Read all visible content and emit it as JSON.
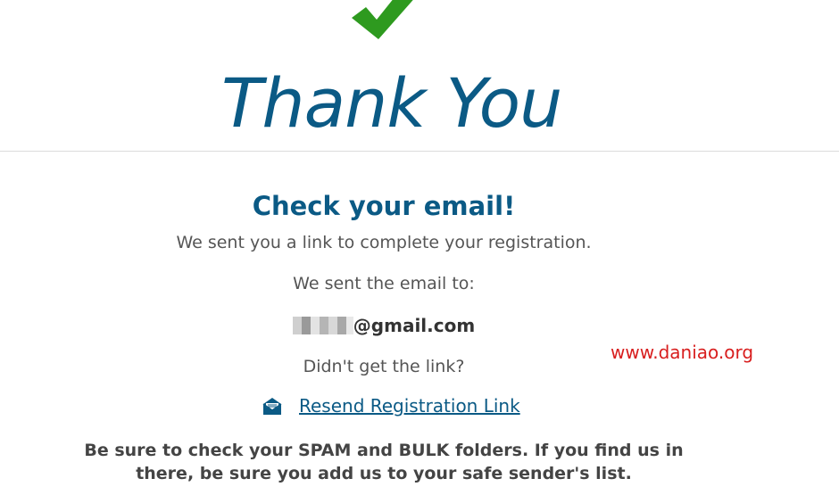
{
  "hero": {
    "title": "Thank You",
    "check_icon": "checkmark-icon",
    "check_color": "#2e9a1f"
  },
  "confirmation": {
    "heading": "Check your email!",
    "sent_link_text": "We sent you a link to complete your registration.",
    "sent_to_label": "We sent the email to:",
    "email_domain": "@gmail.com",
    "didnt_get_text": "Didn't get the link?",
    "resend_icon": "open-envelope-icon",
    "resend_label": "Resend Registration Link",
    "spam_notice": "Be sure to check your SPAM and BULK folders. If you find us in there, be sure you add us to your safe sender's list."
  },
  "watermark": {
    "text": "www.daniao.org",
    "color": "#d81e1e"
  },
  "colors": {
    "brand_blue": "#0b5a85",
    "body_text": "#555555"
  }
}
